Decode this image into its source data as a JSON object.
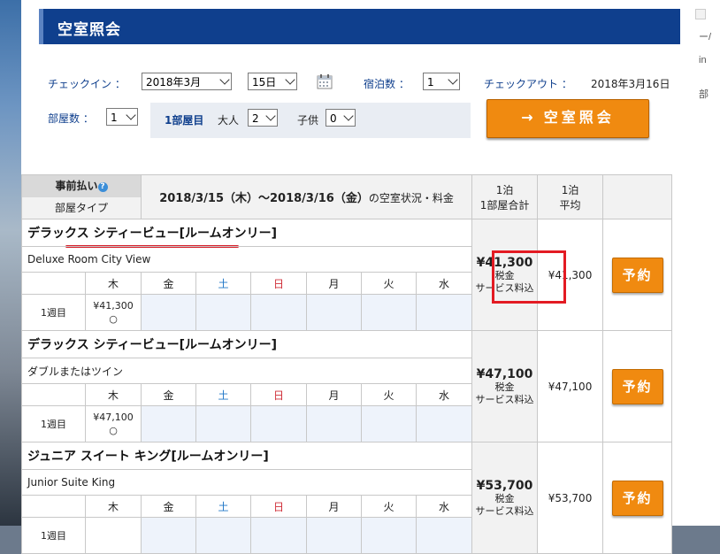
{
  "title": "空室照会",
  "search": {
    "checkin_label": "チェックイン ：",
    "month_value": "2018年3月",
    "day_value": "15日",
    "nights_label": "宿泊数 ：",
    "nights_value": "1",
    "checkout_label": "チェックアウト ：",
    "checkout_value": "2018年3月16日",
    "rooms_label": "部屋数 ：",
    "rooms_value": "1",
    "room1_label": "1部屋目",
    "adults_label": "大人",
    "adults_value": "2",
    "children_label": "子供",
    "children_value": "0",
    "search_button": "空室照会",
    "search_arrow": "→"
  },
  "table": {
    "prepay_label": "事前払い",
    "roomtype_label": "部屋タイプ",
    "date_range": "2018/3/15（木）～2018/3/16（金）",
    "date_suffix": "の空室状況・料金",
    "total_header_1": "1泊",
    "total_header_2": "1部屋合計",
    "avg_header_1": "1泊",
    "avg_header_2": "平均",
    "days": [
      "木",
      "金",
      "土",
      "日",
      "月",
      "火",
      "水"
    ],
    "week_label": "1週目",
    "tax_line1": "税金",
    "tax_line2": "サービス料込",
    "book_label": "予約"
  },
  "rooms": [
    {
      "name": "デラックス シティービュー[ルームオンリー]",
      "sub": "Deluxe Room City View",
      "price": "¥41,300",
      "avail": "○",
      "total": "¥41,300",
      "avg": "¥41,300"
    },
    {
      "name": "デラックス シティービュー[ルームオンリー]",
      "sub": "ダブルまたはツイン",
      "price": "¥47,100",
      "avail": "○",
      "total": "¥47,100",
      "avg": "¥47,100"
    },
    {
      "name": "ジュニア スイート キング[ルームオンリー]",
      "sub": "Junior Suite King",
      "price": "",
      "avail": "",
      "total": "¥53,700",
      "avg": "¥53,700"
    }
  ],
  "right_strip": [
    "ー/",
    "in",
    "部"
  ],
  "colors": {
    "navy": "#0f3f8d",
    "orange": "#f08a10",
    "highlight_red": "#e31b23",
    "saturday": "#2278c8",
    "sunday": "#d0303a"
  }
}
